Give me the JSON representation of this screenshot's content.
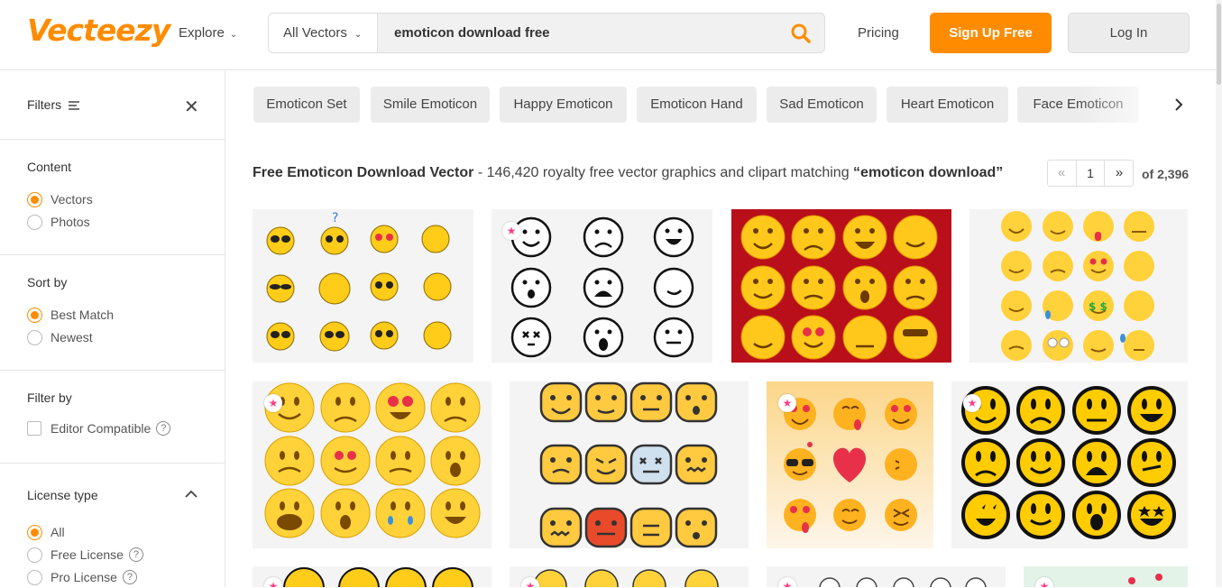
{
  "header": {
    "logo": "Vecteezy",
    "explore": "Explore",
    "search_type": "All Vectors",
    "search_value": "emoticon download free",
    "pricing": "Pricing",
    "signup": "Sign Up Free",
    "login": "Log In"
  },
  "sidebar": {
    "filters_label": "Filters",
    "content": {
      "title": "Content",
      "options": [
        "Vectors",
        "Photos"
      ],
      "selected": "Vectors"
    },
    "sort": {
      "title": "Sort by",
      "options": [
        "Best Match",
        "Newest"
      ],
      "selected": "Best Match"
    },
    "filter_by": {
      "title": "Filter by",
      "option": "Editor Compatible"
    },
    "license": {
      "title": "License type",
      "options": [
        "All",
        "Free License",
        "Pro License"
      ],
      "selected": "All"
    }
  },
  "tags": [
    "Emoticon Set",
    "Smile Emoticon",
    "Happy Emoticon",
    "Emoticon Hand",
    "Sad Emoticon",
    "Heart Emoticon",
    "Face Emoticon"
  ],
  "results": {
    "title": "Free Emoticon Download Vector",
    "summary": "- 146,420 royalty free vector graphics and clipart matching",
    "query": "“emoticon download”",
    "page": "1",
    "of_pages": "of 2,396"
  },
  "colors": {
    "accent": "#ff8c00",
    "emoji_yellow": "#ffcc1a",
    "card_bg": "#f4f4f4",
    "pro_star": "#ff3d8a"
  }
}
